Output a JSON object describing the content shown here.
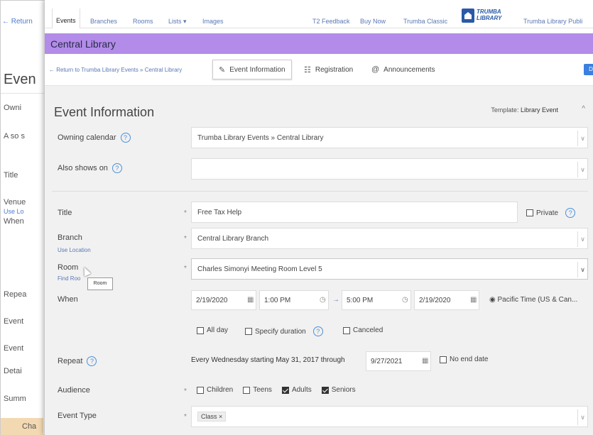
{
  "background": {
    "return_link": "← Return",
    "title": "Even",
    "labels": [
      "Owni",
      "A so s",
      "Title",
      "Venue",
      "When",
      "Repea",
      "Event",
      "Event",
      "Detai",
      "Summ"
    ],
    "use_link": "Use Lo",
    "footer": "Cha"
  },
  "topnav": {
    "items": [
      {
        "label": "Events"
      },
      {
        "label": "Branches"
      },
      {
        "label": "Rooms"
      },
      {
        "label": "Lists ▾"
      },
      {
        "label": "Images"
      },
      {
        "label": "T2 Feedback"
      },
      {
        "label": "Buy Now"
      },
      {
        "label": "Trumba Classic"
      },
      {
        "label": "Trumba Library Publi"
      }
    ],
    "logo_line1": "TRUMBA",
    "logo_line2": "LIBRARY"
  },
  "header": {
    "title": "Central Library"
  },
  "toolbar": {
    "breadcrumb": "← Return to Trumba Library Events » Central Library",
    "tabs": [
      {
        "label": "Event Information",
        "icon": "edit-icon"
      },
      {
        "label": "Registration",
        "icon": "registration-icon"
      },
      {
        "label": "Announcements",
        "icon": "at-icon"
      }
    ],
    "save_label": "D"
  },
  "panel": {
    "title": "Event Information",
    "template_prefix": "Template:",
    "template_value": "Library Event",
    "fields": {
      "owning_calendar": {
        "label": "Owning calendar",
        "value": "Trumba Library Events » Central Library"
      },
      "also_shows_on": {
        "label": "Also shows on",
        "value": ""
      },
      "title": {
        "label": "Title",
        "value": "Free Tax Help",
        "private_label": "Private"
      },
      "branch": {
        "label": "Branch",
        "sub_link": "Use Location",
        "value": "Central Library Branch"
      },
      "room": {
        "label": "Room",
        "sub_link": "Find Roo",
        "value": "Charles Simonyi Meeting Room Level 5",
        "tooltip": "Room"
      },
      "when": {
        "label": "When",
        "start_date": "2/19/2020",
        "start_time": "1:00 PM",
        "end_time": "5:00 PM",
        "end_date": "2/19/2020",
        "timezone": "Pacific Time (US & Can...",
        "all_day": "All day",
        "specify_duration": "Specify duration",
        "canceled": "Canceled"
      },
      "repeat": {
        "label": "Repeat",
        "text": "Every Wednesday starting May 31, 2017 through",
        "end": "9/27/2021",
        "no_end": "No end date"
      },
      "audience": {
        "label": "Audience",
        "options": [
          {
            "label": "Children",
            "checked": false
          },
          {
            "label": "Teens",
            "checked": false
          },
          {
            "label": "Adults",
            "checked": true
          },
          {
            "label": "Seniors",
            "checked": true
          }
        ]
      },
      "event_type": {
        "label": "Event Type",
        "tag": "Class ×"
      }
    },
    "required_mark": "*"
  }
}
